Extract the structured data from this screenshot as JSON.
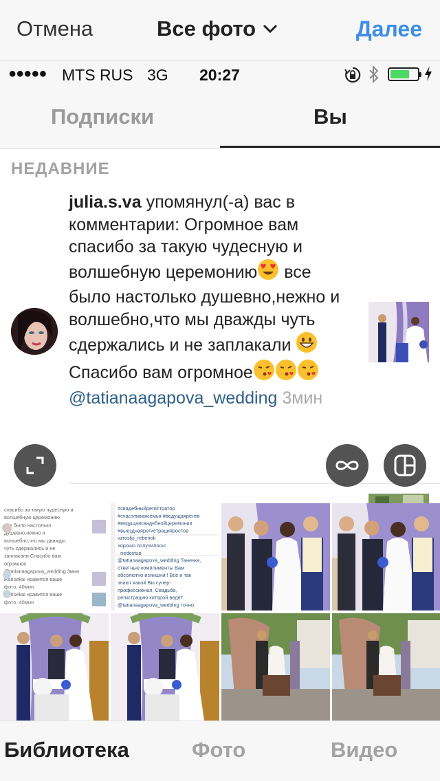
{
  "topbar": {
    "cancel": "Отмена",
    "title": "Все фото",
    "next": "Далее"
  },
  "status": {
    "dots": "●●●●●",
    "carrier": "MTS RUS",
    "network": "3G",
    "time": "20:27",
    "battery_level": 0.7,
    "battery_color": "#4cd964"
  },
  "tabs": {
    "following": "Подписки",
    "you": "Вы"
  },
  "activity": {
    "section": "НЕДАВНИЕ",
    "notification": {
      "username": "julia.s.va",
      "text_part1": " упомянул(-а) вас в комментарии: Огромное вам спасибо за такую чудесную и волшебную церемонию",
      "text_part2": " все было настолько душевно,нежно и волшебно,что мы дважды чуть сдержались и не заплакали",
      "text_part3": " Спасибо вам огромное",
      "mention": "@tatianaagapova_wedding",
      "time": " 3мин"
    }
  },
  "grid": {
    "cell1_lines": [
      "спасибо за такую чудесную и",
      "волшебную церемонию",
      "все было настолько",
      "душевно,нежно и",
      "волшебно,что мы дважды",
      "чуть сдержались и не",
      "заплакали Спасибо вам",
      "огромное",
      "@tatianaagapova_wedding 3мин",
      "ikarisekai нравится ваше",
      "фото. 40мин",
      "ikarisekai нравится ваше",
      "фото. 40мин"
    ],
    "cell2_lines": [
      "#свадебныйрегистратор",
      "#счастливаясемья #ведущаярентв",
      "#ведущаясвадебнойцеремонии",
      "#выезднаярегистрацияростов",
      "vzroslyi_rebenok",
      "хорошо получилось!",
      "_nedostup_",
      "@tatianaagapova_wedding Танечка,",
      "ответные комплименты Вам",
      "абсолютно излишни!! Все и так",
      "знают какой Вы супер-",
      "профессионал. Свадьба,",
      "регистрацию которой ведёт",
      "@tatianaagapova_wedding точно"
    ]
  },
  "bottom": {
    "library": "Библиотека",
    "photo": "Фото",
    "video": "Видео"
  },
  "colors": {
    "accent": "#3d8ee5",
    "mention": "#2f5f8a"
  },
  "icons": [
    "chevron-down-icon",
    "lock-rotation-icon",
    "bluetooth-icon",
    "battery-icon",
    "charging-bolt-icon",
    "expand-icon",
    "boomerang-icon",
    "layout-icon"
  ]
}
